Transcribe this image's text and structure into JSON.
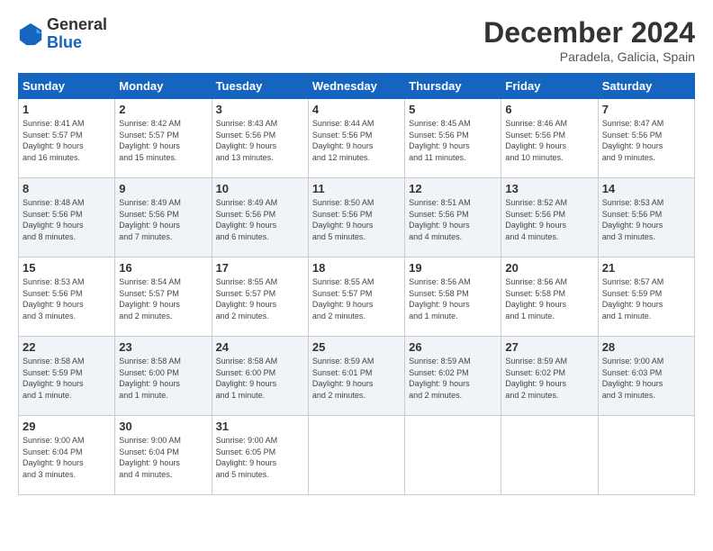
{
  "header": {
    "logo_general": "General",
    "logo_blue": "Blue",
    "month_title": "December 2024",
    "location": "Paradela, Galicia, Spain"
  },
  "weekdays": [
    "Sunday",
    "Monday",
    "Tuesday",
    "Wednesday",
    "Thursday",
    "Friday",
    "Saturday"
  ],
  "weeks": [
    [
      {
        "day": "1",
        "details": "Sunrise: 8:41 AM\nSunset: 5:57 PM\nDaylight: 9 hours\nand 16 minutes."
      },
      {
        "day": "2",
        "details": "Sunrise: 8:42 AM\nSunset: 5:57 PM\nDaylight: 9 hours\nand 15 minutes."
      },
      {
        "day": "3",
        "details": "Sunrise: 8:43 AM\nSunset: 5:56 PM\nDaylight: 9 hours\nand 13 minutes."
      },
      {
        "day": "4",
        "details": "Sunrise: 8:44 AM\nSunset: 5:56 PM\nDaylight: 9 hours\nand 12 minutes."
      },
      {
        "day": "5",
        "details": "Sunrise: 8:45 AM\nSunset: 5:56 PM\nDaylight: 9 hours\nand 11 minutes."
      },
      {
        "day": "6",
        "details": "Sunrise: 8:46 AM\nSunset: 5:56 PM\nDaylight: 9 hours\nand 10 minutes."
      },
      {
        "day": "7",
        "details": "Sunrise: 8:47 AM\nSunset: 5:56 PM\nDaylight: 9 hours\nand 9 minutes."
      }
    ],
    [
      {
        "day": "8",
        "details": "Sunrise: 8:48 AM\nSunset: 5:56 PM\nDaylight: 9 hours\nand 8 minutes."
      },
      {
        "day": "9",
        "details": "Sunrise: 8:49 AM\nSunset: 5:56 PM\nDaylight: 9 hours\nand 7 minutes."
      },
      {
        "day": "10",
        "details": "Sunrise: 8:49 AM\nSunset: 5:56 PM\nDaylight: 9 hours\nand 6 minutes."
      },
      {
        "day": "11",
        "details": "Sunrise: 8:50 AM\nSunset: 5:56 PM\nDaylight: 9 hours\nand 5 minutes."
      },
      {
        "day": "12",
        "details": "Sunrise: 8:51 AM\nSunset: 5:56 PM\nDaylight: 9 hours\nand 4 minutes."
      },
      {
        "day": "13",
        "details": "Sunrise: 8:52 AM\nSunset: 5:56 PM\nDaylight: 9 hours\nand 4 minutes."
      },
      {
        "day": "14",
        "details": "Sunrise: 8:53 AM\nSunset: 5:56 PM\nDaylight: 9 hours\nand 3 minutes."
      }
    ],
    [
      {
        "day": "15",
        "details": "Sunrise: 8:53 AM\nSunset: 5:56 PM\nDaylight: 9 hours\nand 3 minutes."
      },
      {
        "day": "16",
        "details": "Sunrise: 8:54 AM\nSunset: 5:57 PM\nDaylight: 9 hours\nand 2 minutes."
      },
      {
        "day": "17",
        "details": "Sunrise: 8:55 AM\nSunset: 5:57 PM\nDaylight: 9 hours\nand 2 minutes."
      },
      {
        "day": "18",
        "details": "Sunrise: 8:55 AM\nSunset: 5:57 PM\nDaylight: 9 hours\nand 2 minutes."
      },
      {
        "day": "19",
        "details": "Sunrise: 8:56 AM\nSunset: 5:58 PM\nDaylight: 9 hours\nand 1 minute."
      },
      {
        "day": "20",
        "details": "Sunrise: 8:56 AM\nSunset: 5:58 PM\nDaylight: 9 hours\nand 1 minute."
      },
      {
        "day": "21",
        "details": "Sunrise: 8:57 AM\nSunset: 5:59 PM\nDaylight: 9 hours\nand 1 minute."
      }
    ],
    [
      {
        "day": "22",
        "details": "Sunrise: 8:58 AM\nSunset: 5:59 PM\nDaylight: 9 hours\nand 1 minute."
      },
      {
        "day": "23",
        "details": "Sunrise: 8:58 AM\nSunset: 6:00 PM\nDaylight: 9 hours\nand 1 minute."
      },
      {
        "day": "24",
        "details": "Sunrise: 8:58 AM\nSunset: 6:00 PM\nDaylight: 9 hours\nand 1 minute."
      },
      {
        "day": "25",
        "details": "Sunrise: 8:59 AM\nSunset: 6:01 PM\nDaylight: 9 hours\nand 2 minutes."
      },
      {
        "day": "26",
        "details": "Sunrise: 8:59 AM\nSunset: 6:02 PM\nDaylight: 9 hours\nand 2 minutes."
      },
      {
        "day": "27",
        "details": "Sunrise: 8:59 AM\nSunset: 6:02 PM\nDaylight: 9 hours\nand 2 minutes."
      },
      {
        "day": "28",
        "details": "Sunrise: 9:00 AM\nSunset: 6:03 PM\nDaylight: 9 hours\nand 3 minutes."
      }
    ],
    [
      {
        "day": "29",
        "details": "Sunrise: 9:00 AM\nSunset: 6:04 PM\nDaylight: 9 hours\nand 3 minutes."
      },
      {
        "day": "30",
        "details": "Sunrise: 9:00 AM\nSunset: 6:04 PM\nDaylight: 9 hours\nand 4 minutes."
      },
      {
        "day": "31",
        "details": "Sunrise: 9:00 AM\nSunset: 6:05 PM\nDaylight: 9 hours\nand 5 minutes."
      },
      null,
      null,
      null,
      null
    ]
  ]
}
